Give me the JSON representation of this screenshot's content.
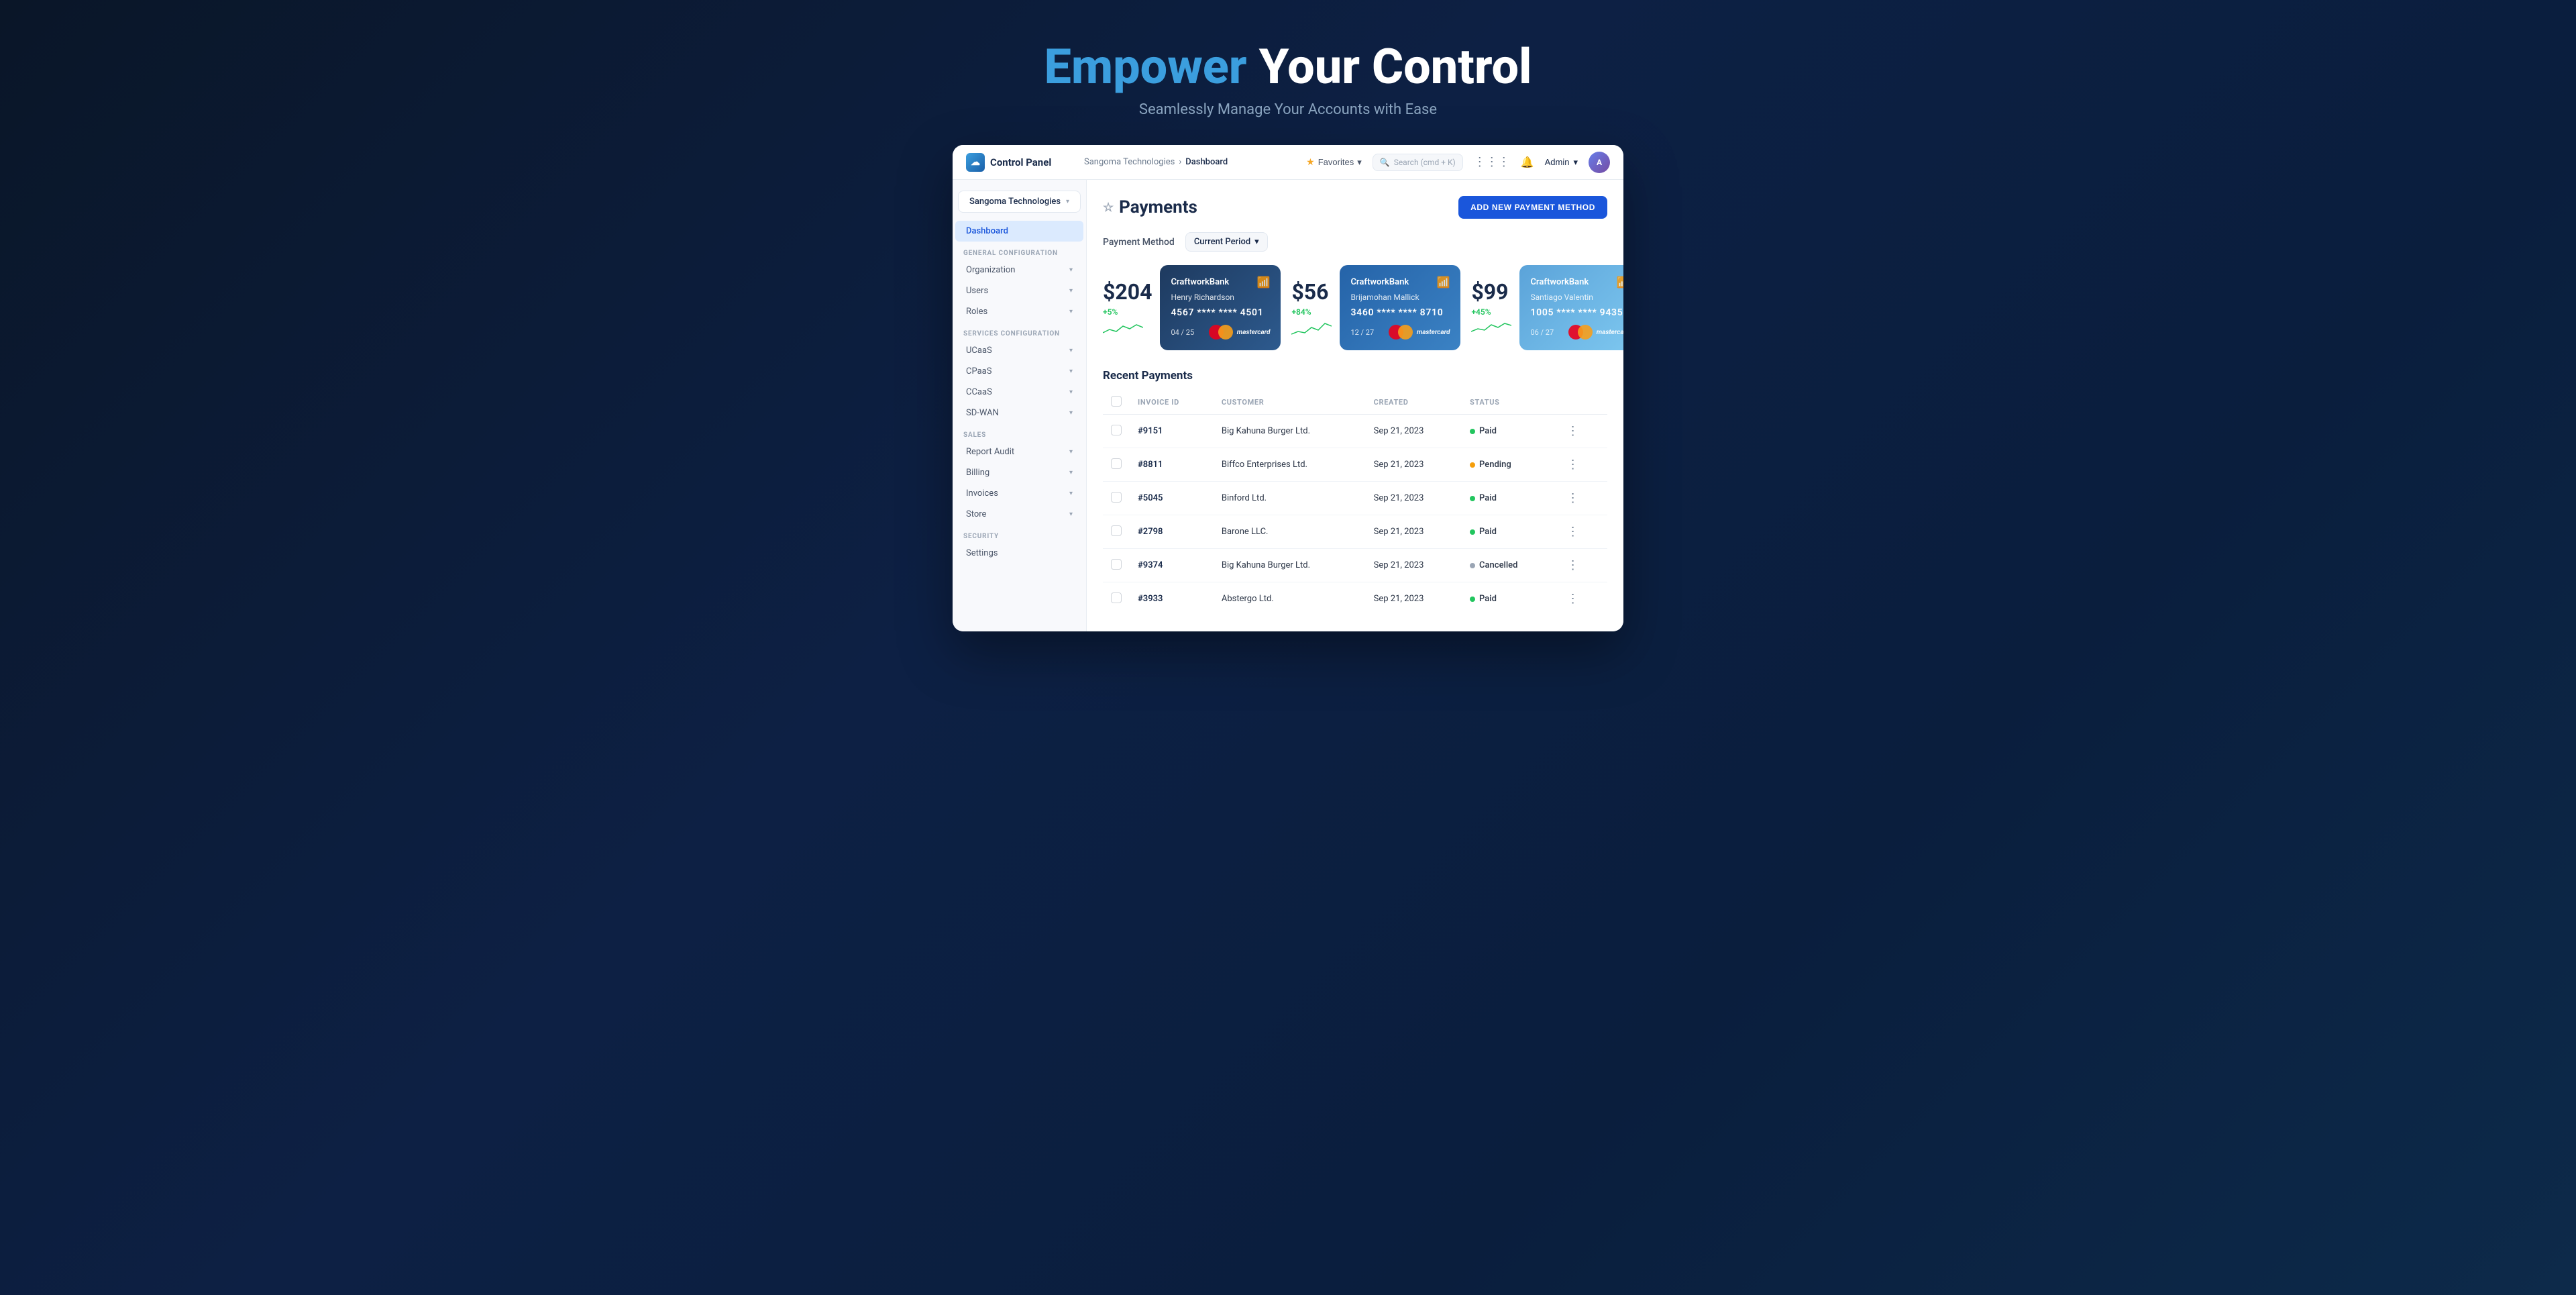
{
  "hero": {
    "title_highlight": "Empower",
    "title_normal": " Your Control",
    "subtitle": "Seamlessly Manage Your Accounts with Ease"
  },
  "topbar": {
    "logo_label": "Control Panel",
    "breadcrumb_parent": "Sangoma Technologies",
    "breadcrumb_separator": ">",
    "breadcrumb_current": "Dashboard",
    "favorites_label": "Favorites",
    "search_placeholder": "Search (cmd + K)",
    "admin_label": "Admin",
    "avatar_initials": "A"
  },
  "sidebar": {
    "org_name": "Sangoma Technologies",
    "active_item": "Dashboard",
    "items_dashboard": [
      "Dashboard"
    ],
    "section_general": "GENERAL CONFIGURATION",
    "items_general": [
      "Organization",
      "Users",
      "Roles"
    ],
    "section_services": "SERVICES CONFIGURATION",
    "items_services": [
      "UCaaS",
      "CPaaS",
      "CCaaS",
      "SD-WAN"
    ],
    "section_sales": "SALES",
    "items_sales": [
      "Report Audit",
      "Billing",
      "Invoices",
      "Store"
    ],
    "section_security": "SECURITY",
    "items_security": [
      "Settings"
    ]
  },
  "page": {
    "title": "Payments",
    "add_btn": "ADD NEW PAYMENT METHOD",
    "filter_label": "Payment Method",
    "period_label": "Current Period"
  },
  "cards": [
    {
      "amount": "$204",
      "change": "+5%",
      "bank": "CraftworkBank",
      "holder": "Henry Richardson",
      "number": "4567 **** **** 4501",
      "expiry": "04 / 25",
      "brand": "mastercard",
      "style": "dark"
    },
    {
      "amount": "$56",
      "change": "+84%",
      "bank": "CraftworkBank",
      "holder": "Brijamohan Mallick",
      "number": "3460 **** **** 8710",
      "expiry": "12 / 27",
      "brand": "mastercard",
      "style": "medium"
    },
    {
      "amount": "$99",
      "change": "+45%",
      "bank": "CraftworkBank",
      "holder": "Santiago Valentin",
      "number": "1005 **** **** 9435",
      "expiry": "06 / 27",
      "brand": "mastercard",
      "style": "light"
    }
  ],
  "recent_payments": {
    "title": "Recent Payments",
    "columns": [
      "INVOICE ID",
      "CUSTOMER",
      "CREATED",
      "STATUS"
    ],
    "rows": [
      {
        "id": "#9151",
        "customer": "Big Kahuna Burger Ltd.",
        "created": "Sep 21, 2023",
        "status": "Paid",
        "status_type": "paid"
      },
      {
        "id": "#8811",
        "customer": "Biffco Enterprises Ltd.",
        "created": "Sep 21, 2023",
        "status": "Pending",
        "status_type": "pending"
      },
      {
        "id": "#5045",
        "customer": "Binford Ltd.",
        "created": "Sep 21, 2023",
        "status": "Paid",
        "status_type": "paid"
      },
      {
        "id": "#2798",
        "customer": "Barone LLC.",
        "created": "Sep 21, 2023",
        "status": "Paid",
        "status_type": "paid"
      },
      {
        "id": "#9374",
        "customer": "Big Kahuna Burger Ltd.",
        "created": "Sep 21, 2023",
        "status": "Cancelled",
        "status_type": "cancelled"
      },
      {
        "id": "#3933",
        "customer": "Abstergo Ltd.",
        "created": "Sep 21, 2023",
        "status": "Paid",
        "status_type": "paid"
      }
    ]
  }
}
